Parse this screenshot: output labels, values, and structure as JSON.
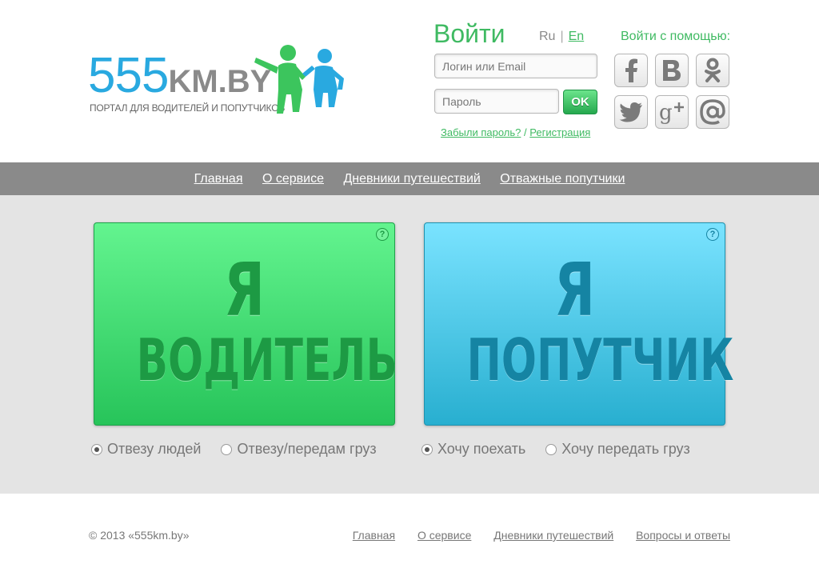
{
  "logo": {
    "number": "555",
    "domain": "KM.BY",
    "tagline": "ПОРТАЛ ДЛЯ ВОДИТЕЛЕЙ И ПОПУТЧИКОВ"
  },
  "login": {
    "title": "Войти",
    "lang_ru": "Ru",
    "lang_sep": "|",
    "lang_en": "En",
    "login_placeholder": "Логин или Email",
    "password_placeholder": "Пароль",
    "ok_label": "OK",
    "forgot": "Забыли пароль?",
    "link_sep": "/",
    "register": "Регистрация"
  },
  "social": {
    "title": "Войти с помощью:",
    "icons": [
      "facebook-icon",
      "vk-icon",
      "odnoklassniki-icon",
      "twitter-icon",
      "google-plus-icon",
      "mail-at-icon"
    ]
  },
  "nav": {
    "items": [
      "Главная",
      "О сервисе",
      "Дневники путешествий",
      "Отважные попутчики"
    ]
  },
  "cards": {
    "driver": {
      "line1": "Я",
      "line2": "ВОДИТЕЛЬ",
      "help": "?",
      "color": "#27c45a"
    },
    "passenger": {
      "line1": "Я",
      "line2": "ПОПУТЧИК",
      "help": "?",
      "color": "#28afd0"
    }
  },
  "options": {
    "driver": [
      "Отвезу людей",
      "Отвезу/передам груз"
    ],
    "passenger": [
      "Хочу поехать",
      "Хочу передать груз"
    ]
  },
  "footer": {
    "copyright": "© 2013 «555km.by»",
    "links": [
      "Главная",
      "О сервисе",
      "Дневники путешествий",
      "Вопросы и ответы"
    ]
  }
}
